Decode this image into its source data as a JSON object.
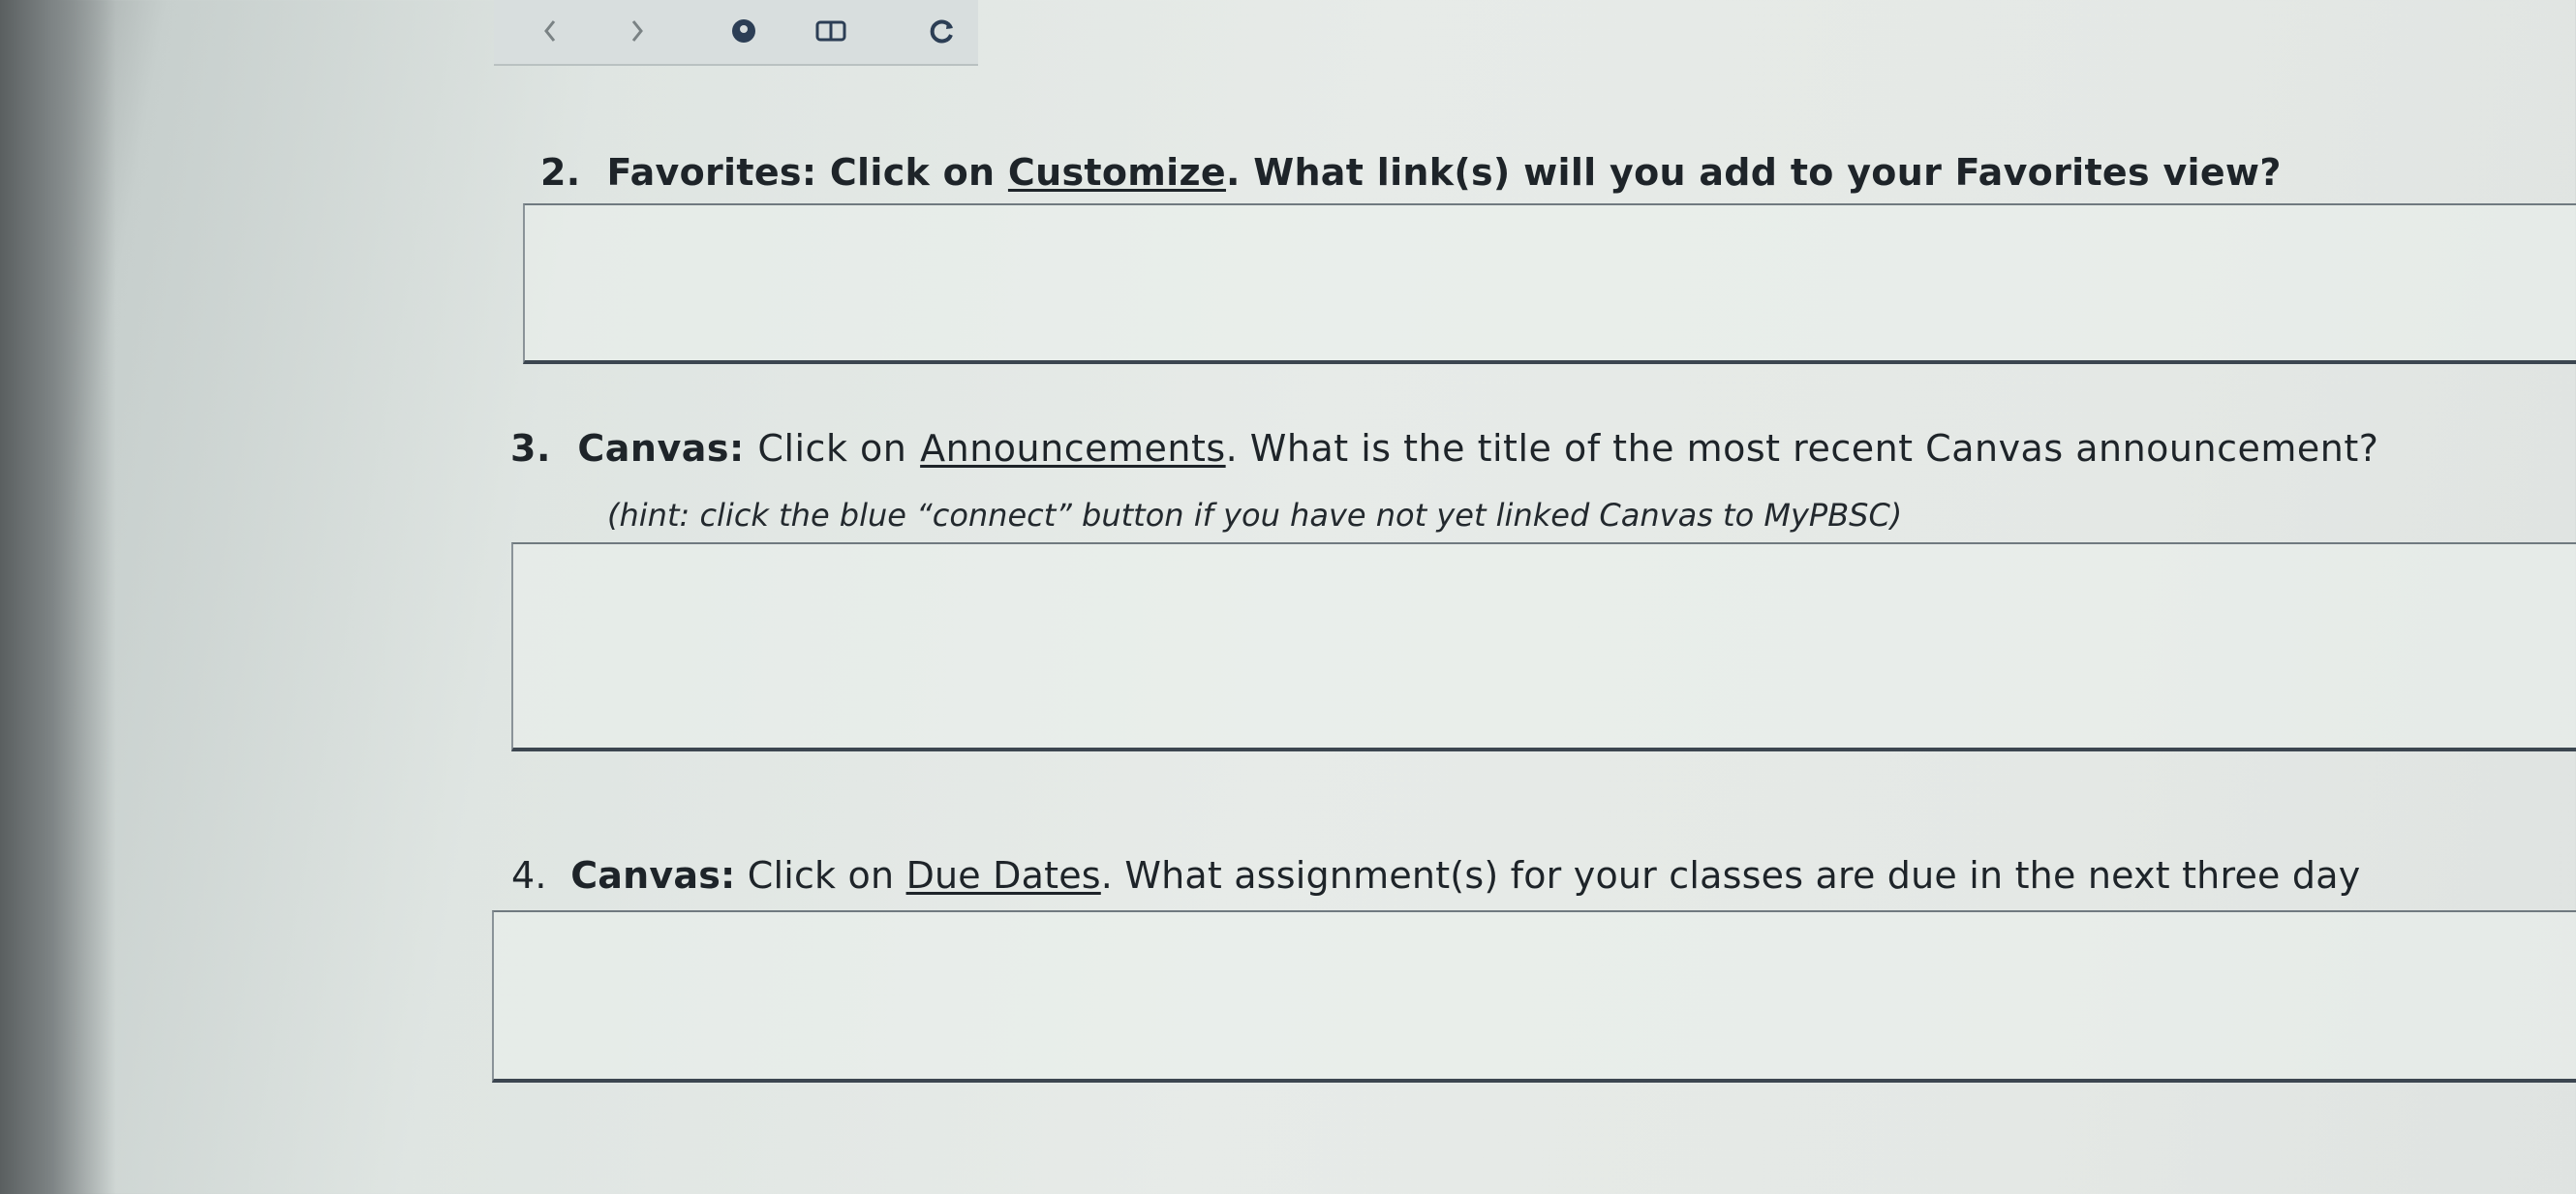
{
  "toolbar": {
    "icons": [
      "back-arrow",
      "forward-arrow",
      "circle-badge",
      "window-icon",
      "refresh-icon"
    ]
  },
  "q2": {
    "number": "2.",
    "lead": "Favorites:",
    "pre": "Click on",
    "link": "Customize",
    "post": ". What link(s) will you add to your Favorites view?"
  },
  "q3": {
    "number": "3.",
    "lead": "Canvas:",
    "pre": "Click on",
    "link": "Announcements",
    "post": ". What is the title of the most recent Canvas announcement?",
    "hint": "(hint: click the blue “connect” button if you have not yet linked Canvas to MyPBSC)"
  },
  "q4": {
    "number": "4.",
    "lead": "Canvas:",
    "pre": "Click on",
    "link": "Due Dates",
    "post": ". What assignment(s) for your classes are due in the next three day"
  },
  "answers": {
    "q2": "",
    "q3": "",
    "q4": ""
  }
}
